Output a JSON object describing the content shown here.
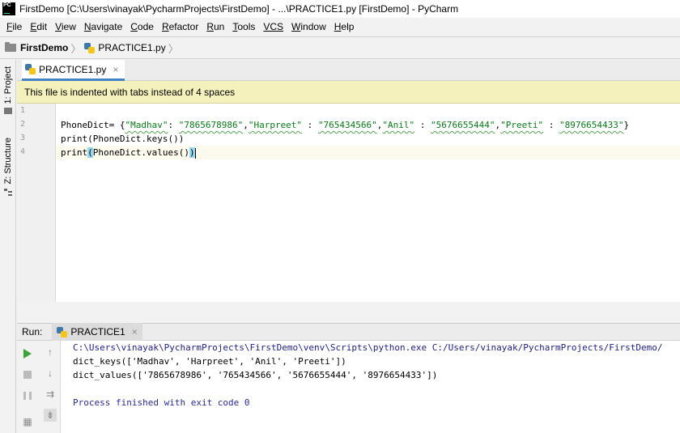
{
  "window": {
    "title": "FirstDemo [C:\\Users\\vinayak\\PycharmProjects\\FirstDemo] - ...\\PRACTICE1.py [FirstDemo] - PyCharm",
    "logo_text": "PC"
  },
  "menu": [
    {
      "u": "F",
      "rest": "ile"
    },
    {
      "u": "E",
      "rest": "dit"
    },
    {
      "u": "V",
      "rest": "iew"
    },
    {
      "u": "N",
      "rest": "avigate"
    },
    {
      "u": "C",
      "rest": "ode"
    },
    {
      "u": "R",
      "rest": "efactor"
    },
    {
      "u": "R",
      "rest": "un"
    },
    {
      "u": "T",
      "rest": "ools"
    },
    {
      "u": "VCS",
      "rest": ""
    },
    {
      "u": "W",
      "rest": "indow"
    },
    {
      "u": "H",
      "rest": "elp"
    }
  ],
  "breadcrumb": {
    "project": "FirstDemo",
    "file": "PRACTICE1.py"
  },
  "left_tabs": {
    "project": "1: Project",
    "structure": "Z: Structure"
  },
  "editor": {
    "tab_label": "PRACTICE1.py",
    "tab_close": "×",
    "notice": "This file is indented with tabs instead of 4 spaces",
    "line_numbers": [
      "1",
      "2",
      "3",
      "4"
    ],
    "line2": {
      "prefix": "PhoneDict= {",
      "k1": "\"Madhav\"",
      "c1": ": ",
      "v1": "\"7865678986\"",
      "k2": "\"Harpreet\"",
      "c2": " : ",
      "v2": "\"765434566\"",
      "k3": "\"Anil\"",
      "c3": " : ",
      "v3": "\"5676655444\"",
      "k4": "\"Preeti\"",
      "c4": " : ",
      "v4": "\"8976654433\"",
      "suffix": "}"
    },
    "line3": "print(PhoneDict.keys())",
    "line4": {
      "a": "print",
      "b": "(",
      "c": "PhoneDict.values()",
      "d": ")"
    }
  },
  "run": {
    "label": "Run:",
    "tab": "PRACTICE1",
    "tab_close": "×",
    "console": {
      "command": "C:\\Users\\vinayak\\PycharmProjects\\FirstDemo\\venv\\Scripts\\python.exe C:/Users/vinayak/PycharmProjects/FirstDemo/",
      "out1": "dict_keys(['Madhav', 'Harpreet', 'Anil', 'Preeti'])",
      "out2": "dict_values(['7865678986', '765434566', '5676655444', '8976654433'])",
      "exit": "Process finished with exit code 0"
    }
  }
}
